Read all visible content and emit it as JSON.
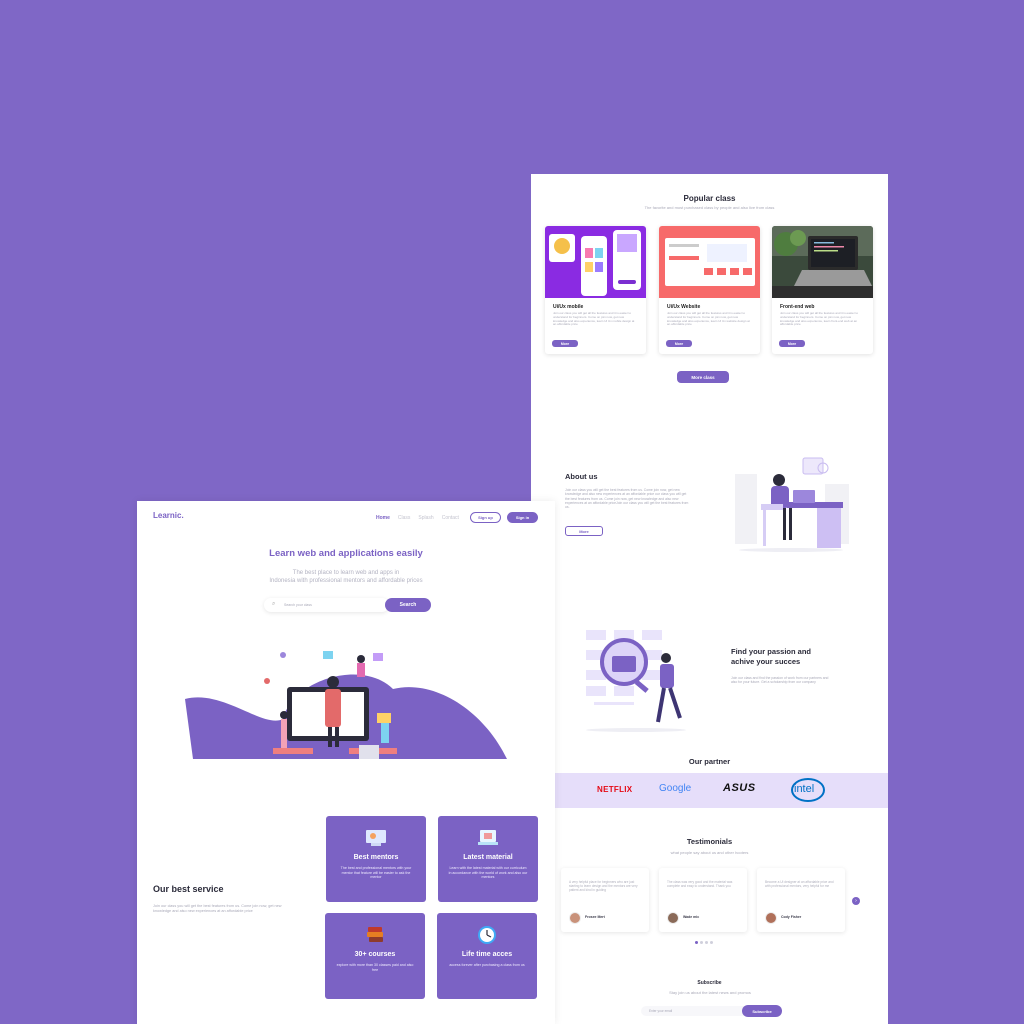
{
  "popular": {
    "title": "Popular class",
    "subtitle": "The favorite and most purchased class by people and also live from class",
    "cards": [
      {
        "title": "Ui/Ux mobile",
        "desc": "Join our class you will get all the features and it is easier to understand for beginners. Come on join now, get new knowledge and also experience, learn UI Ux mobile design at an affordable price",
        "button": "More"
      },
      {
        "title": "Ui/Ux Website",
        "desc": "Join our class you will get all the features and it is easier to understand for beginners. Come on join now, get new knowledge and also experience, learn UI Ux website design at an affordable price",
        "button": "More"
      },
      {
        "title": "Front-end web",
        "desc": "Join our class you will get all the features and it is easier to understand for beginners. Come on join now, get new knowledge and also experience, learn front-end web at an affordable price",
        "button": "More"
      }
    ],
    "more_button": "More class"
  },
  "about": {
    "title": "About us",
    "desc": "Join our class you will get the best features from us. Come join now, get new knowledge and also new experiences at an affordable price our class you will get the best features from us. Come join now, get new knowledge and also new experiences at an affordable priceJoin our class you will get the best features from us.",
    "button": "More"
  },
  "passion": {
    "title_line1": "Find your passion and",
    "title_line2": "achive your succes",
    "desc": "Join our class and find the passion of work from our partners and also for your future. Get a scholarship from our company"
  },
  "partner": {
    "title": "Our partner",
    "logos": [
      "NETFLIX",
      "Google",
      "ASUS",
      "intel"
    ]
  },
  "testimonials": {
    "title": "Testimonials",
    "subtitle": "what people say about us and other hooters",
    "items": [
      {
        "text": "A very helpful place for beginners who are just starting to learn design and the mentors are very patient and kind in guiding",
        "name": "Frosee Mert"
      },
      {
        "text": "The class was very good and the material was complete and easy to understand. Thank you",
        "name": "Wade mic"
      },
      {
        "text": "Become a UI designer at an affordable price and with professional mentors, very helpful for me",
        "name": "Cody Fisher"
      }
    ]
  },
  "subscribe": {
    "title": "Subscribe",
    "subtitle": "Stay join us about the latest news and promos",
    "placeholder": "Enter your email",
    "button": "Subscribe"
  },
  "header": {
    "logo": "Learnic.",
    "nav": [
      "Home",
      "Class",
      "Splash",
      "Contact"
    ],
    "signup": "Sign up",
    "signin": "Sign in"
  },
  "hero": {
    "title": "Learn web and applications easily",
    "subtitle_line1": "The best place to learn web and apps in",
    "subtitle_line2": "Indonesia with professional mentors and affordable prices",
    "search_placeholder": "Search your class",
    "search_button": "Search"
  },
  "service": {
    "title": "Our best service",
    "desc": "Join our class you will get the best features from us. Come join now, get new knowledge and also new experiences at an affordable price",
    "items": [
      {
        "title": "Best mentors",
        "desc": "The best and professional mentors with your mentor that feature will be easier to ask the mentor"
      },
      {
        "title": "Latest material",
        "desc": "Learn with the latest material with our curriculum in accordance with the world of work and also our mentors"
      },
      {
        "title": "30+ courses",
        "desc": "explore with more than 30 classes paid and also free"
      },
      {
        "title": "Life time acces",
        "desc": "access forever after purchasing a class from us"
      }
    ]
  },
  "colors": {
    "background": "#7f67c6",
    "accent": "#7b62c4",
    "partner_band": "#e6defa"
  }
}
